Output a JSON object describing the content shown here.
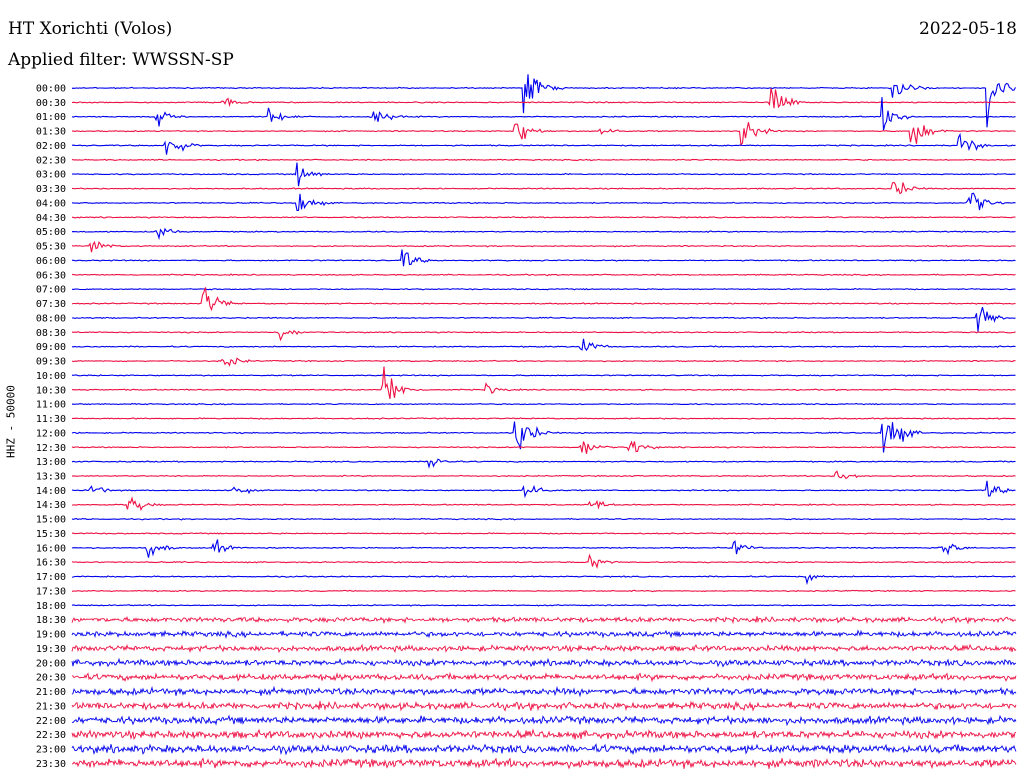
{
  "header": {
    "station": "HT Xorichti (Volos)",
    "date": "2022-05-18",
    "filter": "Applied filter: WWSSN-SP",
    "channel": "HHZ - 50000"
  },
  "chart_data": {
    "type": "line",
    "chart_kind": "helicorder",
    "colors": {
      "blue": "#0000ee",
      "red": "#ee1144"
    },
    "trace_colors": [
      "blue",
      "red"
    ],
    "y_tick_labels": [
      "00:00",
      "00:30",
      "01:00",
      "01:30",
      "02:00",
      "02:30",
      "03:00",
      "03:30",
      "04:00",
      "04:30",
      "05:00",
      "05:30",
      "06:00",
      "06:30",
      "07:00",
      "07:30",
      "08:00",
      "08:30",
      "09:00",
      "09:30",
      "10:00",
      "10:30",
      "11:00",
      "11:30",
      "12:00",
      "12:30",
      "13:00",
      "13:30",
      "14:00",
      "14:30",
      "15:00",
      "15:30",
      "16:00",
      "16:30",
      "17:00",
      "17:30",
      "18:00",
      "18:30",
      "19:00",
      "19:30",
      "20:00",
      "20:30",
      "21:00",
      "21:30",
      "22:00",
      "22:30",
      "23:00",
      "23:30"
    ],
    "noise_onset_row": 37,
    "events": [
      {
        "row": 0,
        "x": 0.48,
        "amp": 40
      },
      {
        "row": 0,
        "x": 0.87,
        "amp": 30
      },
      {
        "row": 0,
        "x": 0.97,
        "amp": 50
      },
      {
        "row": 1,
        "x": 0.16,
        "amp": 12
      },
      {
        "row": 1,
        "x": 0.74,
        "amp": 40
      },
      {
        "row": 2,
        "x": 0.09,
        "amp": 14
      },
      {
        "row": 2,
        "x": 0.21,
        "amp": 14
      },
      {
        "row": 2,
        "x": 0.32,
        "amp": 20
      },
      {
        "row": 2,
        "x": 0.86,
        "amp": 25
      },
      {
        "row": 3,
        "x": 0.47,
        "amp": 30
      },
      {
        "row": 3,
        "x": 0.56,
        "amp": 10
      },
      {
        "row": 3,
        "x": 0.71,
        "amp": 30
      },
      {
        "row": 3,
        "x": 0.89,
        "amp": 35
      },
      {
        "row": 4,
        "x": 0.1,
        "amp": 30
      },
      {
        "row": 4,
        "x": 0.94,
        "amp": 25
      },
      {
        "row": 6,
        "x": 0.24,
        "amp": 20
      },
      {
        "row": 7,
        "x": 0.87,
        "amp": 20
      },
      {
        "row": 8,
        "x": 0.24,
        "amp": 22
      },
      {
        "row": 8,
        "x": 0.95,
        "amp": 30
      },
      {
        "row": 10,
        "x": 0.09,
        "amp": 14
      },
      {
        "row": 11,
        "x": 0.02,
        "amp": 14
      },
      {
        "row": 12,
        "x": 0.35,
        "amp": 20
      },
      {
        "row": 15,
        "x": 0.14,
        "amp": 30
      },
      {
        "row": 16,
        "x": 0.96,
        "amp": 30
      },
      {
        "row": 17,
        "x": 0.22,
        "amp": 14
      },
      {
        "row": 18,
        "x": 0.54,
        "amp": 18
      },
      {
        "row": 19,
        "x": 0.16,
        "amp": 16
      },
      {
        "row": 21,
        "x": 0.33,
        "amp": 45
      },
      {
        "row": 21,
        "x": 0.44,
        "amp": 10
      },
      {
        "row": 24,
        "x": 0.47,
        "amp": 45
      },
      {
        "row": 24,
        "x": 0.86,
        "amp": 55
      },
      {
        "row": 25,
        "x": 0.54,
        "amp": 18
      },
      {
        "row": 25,
        "x": 0.59,
        "amp": 18
      },
      {
        "row": 26,
        "x": 0.38,
        "amp": 14
      },
      {
        "row": 27,
        "x": 0.81,
        "amp": 18
      },
      {
        "row": 28,
        "x": 0.02,
        "amp": 12
      },
      {
        "row": 28,
        "x": 0.17,
        "amp": 12
      },
      {
        "row": 28,
        "x": 0.48,
        "amp": 20
      },
      {
        "row": 28,
        "x": 0.97,
        "amp": 16
      },
      {
        "row": 29,
        "x": 0.06,
        "amp": 22
      },
      {
        "row": 29,
        "x": 0.55,
        "amp": 12
      },
      {
        "row": 32,
        "x": 0.08,
        "amp": 20
      },
      {
        "row": 32,
        "x": 0.15,
        "amp": 14
      },
      {
        "row": 32,
        "x": 0.7,
        "amp": 14
      },
      {
        "row": 32,
        "x": 0.92,
        "amp": 20
      },
      {
        "row": 33,
        "x": 0.55,
        "amp": 14
      },
      {
        "row": 34,
        "x": 0.78,
        "amp": 8
      }
    ]
  }
}
